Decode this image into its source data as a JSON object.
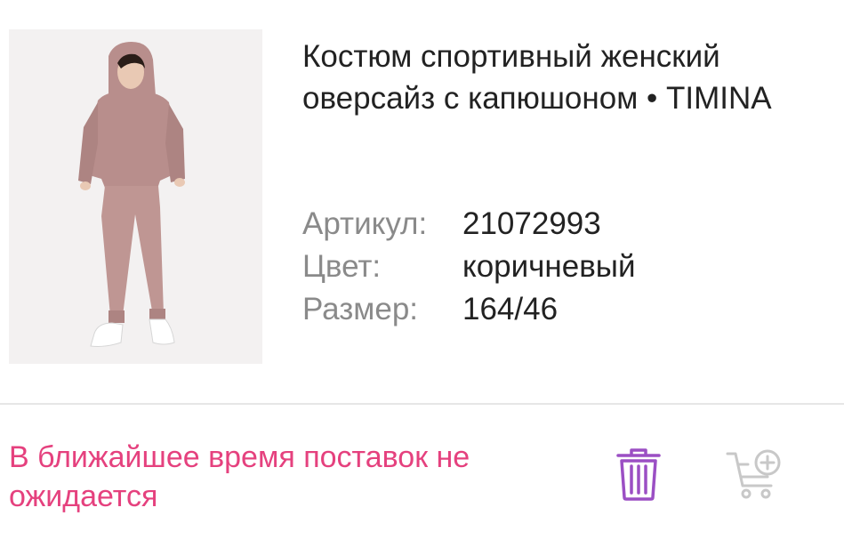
{
  "product": {
    "title": "Костюм спортивный женский оверсайз с капюшоном • TIMINA",
    "image_alt": "product photo",
    "specs": [
      {
        "label": "Артикул:",
        "value": "21072993"
      },
      {
        "label": "Цвет:",
        "value": "коричневый"
      },
      {
        "label": "Размер:",
        "value": "164/46"
      }
    ]
  },
  "availability": {
    "text": "В ближайшее время поставок не ожидается",
    "color": "#e5417e"
  },
  "actions": {
    "delete_icon": "trash-icon",
    "delete_color": "#9b4fc4",
    "cart_icon": "cart-add-icon",
    "cart_color": "#c8c8c8"
  }
}
